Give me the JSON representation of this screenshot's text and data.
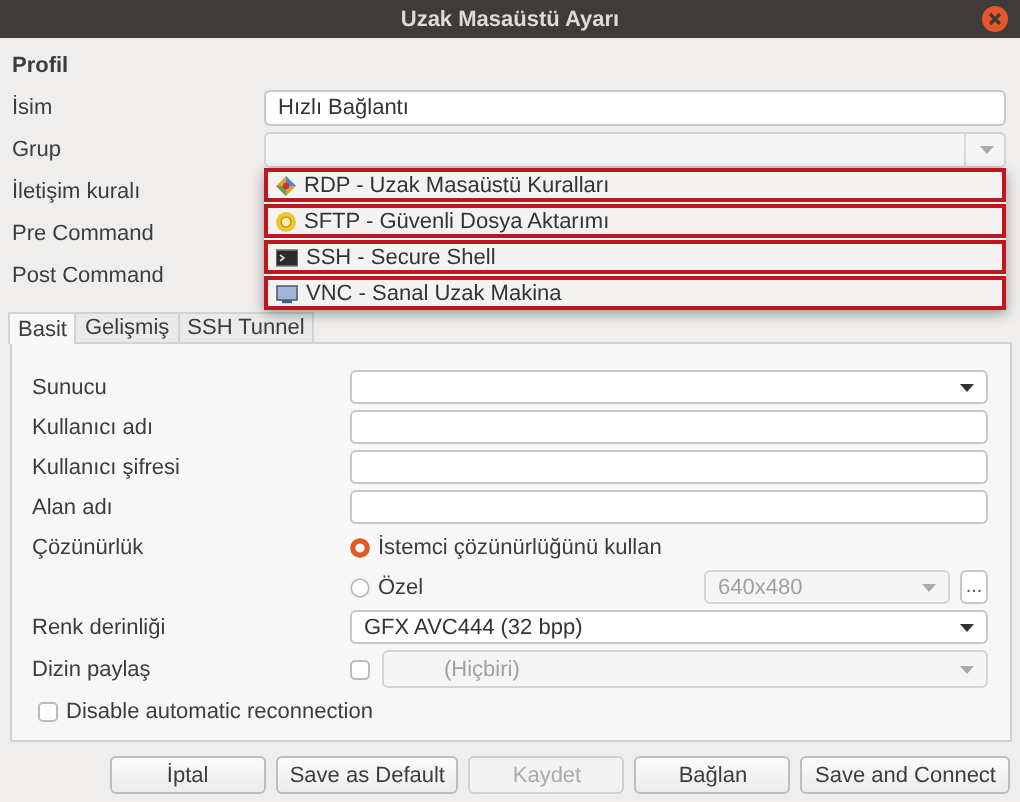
{
  "window": {
    "title": "Uzak Masaüstü Ayarı"
  },
  "profile": {
    "heading": "Profil",
    "rows": [
      {
        "label": "İsim",
        "kind": "text",
        "value": "Hızlı Bağlantı"
      },
      {
        "label": "Grup",
        "kind": "combo",
        "disabled": true
      },
      {
        "label": "İletişim kuralı",
        "kind": "covered"
      },
      {
        "label": "Pre Command",
        "kind": "covered"
      },
      {
        "label": "Post Command",
        "kind": "covered"
      }
    ]
  },
  "protocol_menu": [
    {
      "label": "RDP - Uzak Masaüstü Kuralları",
      "kind": "rdp"
    },
    {
      "label": "SFTP - Güvenli Dosya Aktarımı",
      "kind": "sftp"
    },
    {
      "label": "SSH - Secure Shell",
      "kind": "ssh"
    },
    {
      "label": "VNC - Sanal Uzak Makina",
      "kind": "vnc"
    }
  ],
  "tabs": [
    {
      "label": "Basit",
      "selected": true
    },
    {
      "label": "Gelişmiş",
      "selected": false
    },
    {
      "label": "SSH Tunnel",
      "selected": false
    }
  ],
  "basic": [
    {
      "kind": "combo",
      "label": "Sunucu",
      "disabled": false
    },
    {
      "kind": "text",
      "label": "Kullanıcı adı"
    },
    {
      "kind": "text",
      "label": "Kullanıcı şifresi"
    },
    {
      "kind": "text",
      "label": "Alan adı"
    },
    {
      "kind": "radio",
      "label": "Çözünürlük",
      "option": "İstemci çözünürlüğünü kullan",
      "selected": true
    },
    {
      "kind": "radio-combo",
      "option": "Özel",
      "selected": false,
      "value": "640x480",
      "disabled": true,
      "button": "..."
    },
    {
      "kind": "combo",
      "label": "Renk derinliği",
      "value": "GFX AVC444 (32 bpp)",
      "disabled": false
    },
    {
      "kind": "check-combo",
      "label": "Dizin paylaş",
      "checked": false,
      "value": "(Hiçbiri)",
      "disabled": true
    },
    {
      "kind": "checkbox",
      "option": "Disable automatic reconnection",
      "checked": false
    }
  ],
  "buttons": [
    {
      "label": "İptal",
      "disabled": false
    },
    {
      "label": "Save as Default",
      "disabled": false
    },
    {
      "label": "Kaydet",
      "disabled": true
    },
    {
      "label": "Bağlan",
      "disabled": false
    },
    {
      "label": "Save and Connect",
      "disabled": false
    }
  ]
}
